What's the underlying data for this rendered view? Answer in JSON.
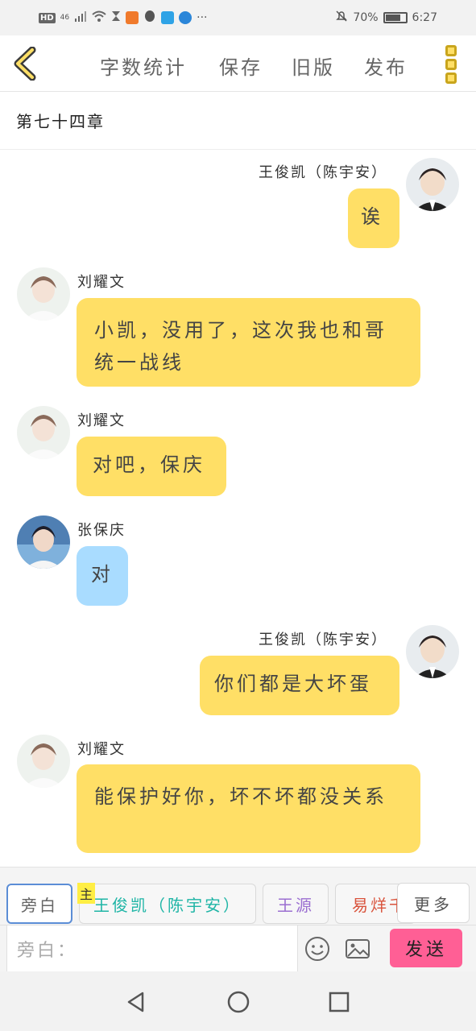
{
  "status_bar": {
    "network": "HD",
    "signal": "46",
    "battery": "70%",
    "time": "6:27",
    "more": "···"
  },
  "nav": {
    "word_count": "字数统计",
    "save": "保存",
    "old_version": "旧版",
    "publish": "发布"
  },
  "chapter_title": "第七十四章",
  "messages": [
    {
      "side": "right",
      "name": "王俊凯（陈宇安）",
      "text": "诶",
      "color": "yellow"
    },
    {
      "side": "left",
      "name": "刘耀文",
      "text": "小凯，没用了，这次我也和哥统一战线",
      "color": "yellow"
    },
    {
      "side": "left",
      "name": "刘耀文",
      "text": "对吧，保庆",
      "color": "yellow"
    },
    {
      "side": "left",
      "name": "张保庆",
      "text": "对",
      "color": "blue"
    },
    {
      "side": "right",
      "name": "王俊凯（陈宇安）",
      "text": "你们都是大坏蛋",
      "color": "yellow"
    },
    {
      "side": "left",
      "name": "刘耀文",
      "text": "能保护好你，坏不坏都没关系",
      "color": "yellow"
    }
  ],
  "roles": [
    {
      "label": "旁白",
      "color": "#666666"
    },
    {
      "label": "王俊凯（陈宇安）",
      "color": "#1fb5a6"
    },
    {
      "label": "王源",
      "color": "#9b6fd1"
    },
    {
      "label": "易烊千玺",
      "color": "#d9533c"
    }
  ],
  "main_tag": "主",
  "more_label": "更多",
  "input": {
    "placeholder": "旁白："
  },
  "send_label": "发送",
  "colors": {
    "bubble_yellow": "#ffdf66",
    "bubble_blue": "#a9dcff",
    "send_pink": "#ff5f95",
    "accent_gold": "#c9a51c"
  }
}
